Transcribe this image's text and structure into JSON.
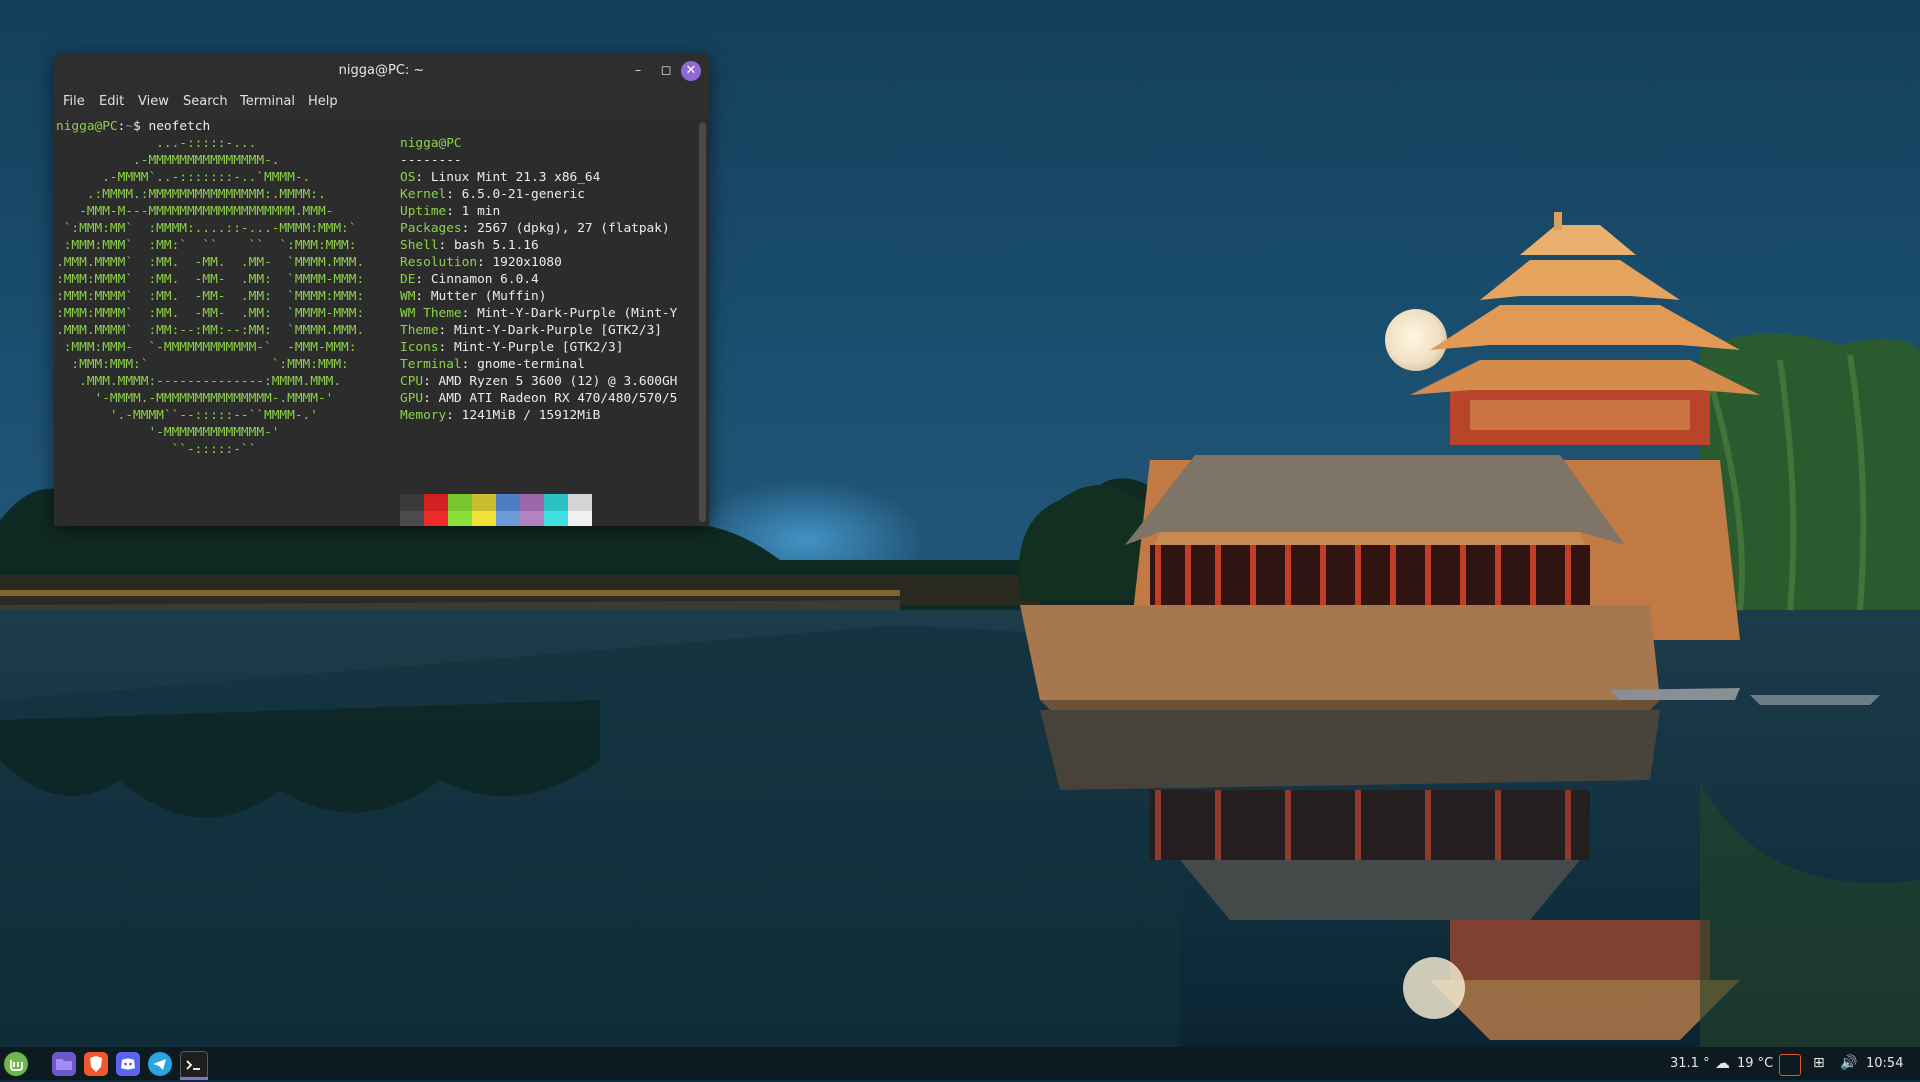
{
  "window": {
    "title": "nigga@PC: ~",
    "menu": [
      "File",
      "Edit",
      "View",
      "Search",
      "Terminal",
      "Help"
    ]
  },
  "terminal": {
    "prompt_user": "nigga@PC",
    "prompt_sep": ":",
    "prompt_path": "~",
    "prompt_symbol": "$",
    "command": "neofetch",
    "logo": [
      "             ...-:::::-...",
      "          .-MMMMMMMMMMMMMMM-.",
      "      .-MMMM`..-:::::::-..`MMMM-.",
      "    .:MMMM.:MMMMMMMMMMMMMMM:.MMMM:.",
      "   -MMM-M---MMMMMMMMMMMMMMMMMMM.MMM-",
      " `:MMM:MM`  :MMMM:....::-...-MMMM:MMM:`",
      " :MMM:MMM`  :MM:`  ``    ``  `:MMM:MMM:",
      ".MMM.MMMM`  :MM.  -MM.  .MM-  `MMMM.MMM.",
      ":MMM:MMMM`  :MM.  -MM-  .MM:  `MMMM-MMM:",
      ":MMM:MMMM`  :MM.  -MM-  .MM:  `MMMM:MMM:",
      ":MMM:MMMM`  :MM.  -MM-  .MM:  `MMMM-MMM:",
      ".MMM.MMMM`  :MM:--:MM:--:MM:  `MMMM.MMM.",
      " :MMM:MMM-  `-MMMMMMMMMMMM-`  -MMM-MMM:",
      "  :MMM:MMM:`                `:MMM:MMM:",
      "   .MMM.MMMM:--------------:MMMM.MMM.",
      "     '-MMMM.-MMMMMMMMMMMMMMM-.MMMM-'",
      "       '.-MMMM``--:::::--``MMMM-.'",
      "            '-MMMMMMMMMMMMM-'",
      "               ``-:::::-``"
    ],
    "header": "nigga@PC",
    "separator": "--------",
    "info": [
      {
        "key": "OS",
        "value": "Linux Mint 21.3 x86_64"
      },
      {
        "key": "Kernel",
        "value": "6.5.0-21-generic"
      },
      {
        "key": "Uptime",
        "value": "1 min"
      },
      {
        "key": "Packages",
        "value": "2567 (dpkg), 27 (flatpak)"
      },
      {
        "key": "Shell",
        "value": "bash 5.1.16"
      },
      {
        "key": "Resolution",
        "value": "1920x1080"
      },
      {
        "key": "DE",
        "value": "Cinnamon 6.0.4"
      },
      {
        "key": "WM",
        "value": "Mutter (Muffin)"
      },
      {
        "key": "WM Theme",
        "value": "Mint-Y-Dark-Purple (Mint-Y"
      },
      {
        "key": "Theme",
        "value": "Mint-Y-Dark-Purple [GTK2/3]"
      },
      {
        "key": "Icons",
        "value": "Mint-Y-Purple [GTK2/3]"
      },
      {
        "key": "Terminal",
        "value": "gnome-terminal"
      },
      {
        "key": "CPU",
        "value": "AMD Ryzen 5 3600 (12) @ 3.600GH"
      },
      {
        "key": "GPU",
        "value": "AMD ATI Radeon RX 470/480/570/5"
      },
      {
        "key": "Memory",
        "value": "1241MiB / 15912MiB"
      }
    ],
    "palette_top": [
      "#3a3a3a",
      "#d31f1f",
      "#79c72e",
      "#c9bd2e",
      "#4f7dc4",
      "#9a68a8",
      "#2cc2c2",
      "#d4d4d4"
    ],
    "palette_bottom": [
      "#4b4b4b",
      "#ee2b2b",
      "#8ae03b",
      "#f1e239",
      "#6d9bd8",
      "#b383c1",
      "#3ee0e0",
      "#f0f0f0"
    ]
  },
  "taskbar": {
    "launchers": [
      "mint-menu-icon",
      "files-icon",
      "brave-icon",
      "discord-icon",
      "telegram-icon",
      "terminal-icon"
    ],
    "cpu_temp": "31.1 °",
    "weather": "19 °C",
    "clock": "10:54"
  },
  "colors": {
    "accent": "#8f6ad0",
    "prompt_green": "#8dd14a",
    "path_blue": "#6b8cd8"
  }
}
